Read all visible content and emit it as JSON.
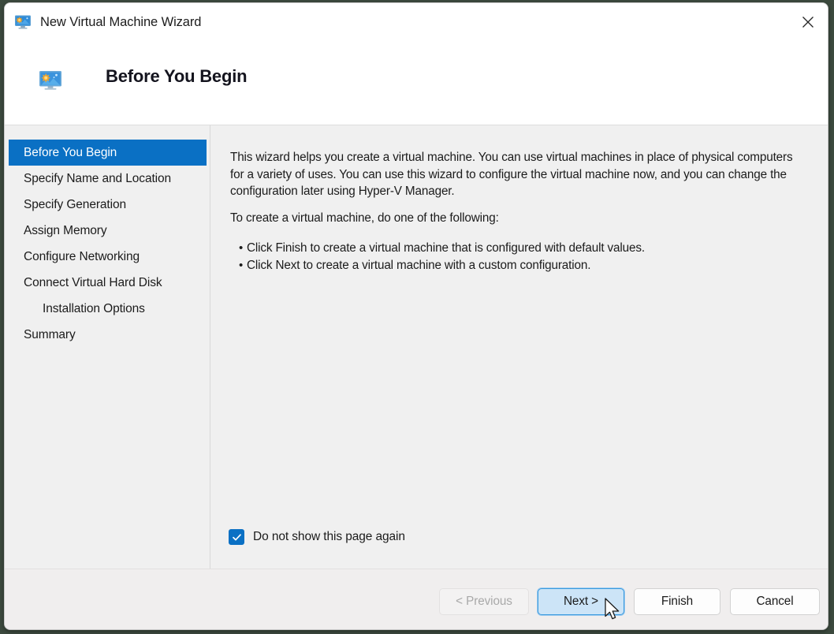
{
  "window": {
    "title": "New Virtual Machine Wizard",
    "title_icon": "virtual-machine-monitor-icon",
    "close_icon": "close-icon"
  },
  "header": {
    "icon": "virtual-machine-monitor-icon",
    "title": "Before You Begin"
  },
  "sidebar": {
    "items": [
      {
        "label": "Before You Begin",
        "selected": true,
        "indented": false
      },
      {
        "label": "Specify Name and Location",
        "selected": false,
        "indented": false
      },
      {
        "label": "Specify Generation",
        "selected": false,
        "indented": false
      },
      {
        "label": "Assign Memory",
        "selected": false,
        "indented": false
      },
      {
        "label": "Configure Networking",
        "selected": false,
        "indented": false
      },
      {
        "label": "Connect Virtual Hard Disk",
        "selected": false,
        "indented": false
      },
      {
        "label": "Installation Options",
        "selected": false,
        "indented": true
      },
      {
        "label": "Summary",
        "selected": false,
        "indented": false
      }
    ],
    "selected_bg": "#0a70c4"
  },
  "content": {
    "intro_paragraph": "This wizard helps you create a virtual machine. You can use virtual machines in place of physical computers for a variety of uses. You can use this wizard to configure the virtual machine now, and you can change the configuration later using Hyper-V Manager.",
    "create_paragraph": "To create a virtual machine, do one of the following:",
    "bullets": [
      "Click Finish to create a virtual machine that is configured with default values.",
      "Click Next to create a virtual machine with a custom configuration."
    ],
    "checkbox": {
      "label": "Do not show this page again",
      "checked": true,
      "accent": "#0a70c4"
    }
  },
  "footer": {
    "buttons": [
      {
        "label": "< Previous",
        "state": "disabled"
      },
      {
        "label": "Next >",
        "state": "focused"
      },
      {
        "label": "Finish",
        "state": "normal"
      },
      {
        "label": "Cancel",
        "state": "normal"
      }
    ]
  }
}
